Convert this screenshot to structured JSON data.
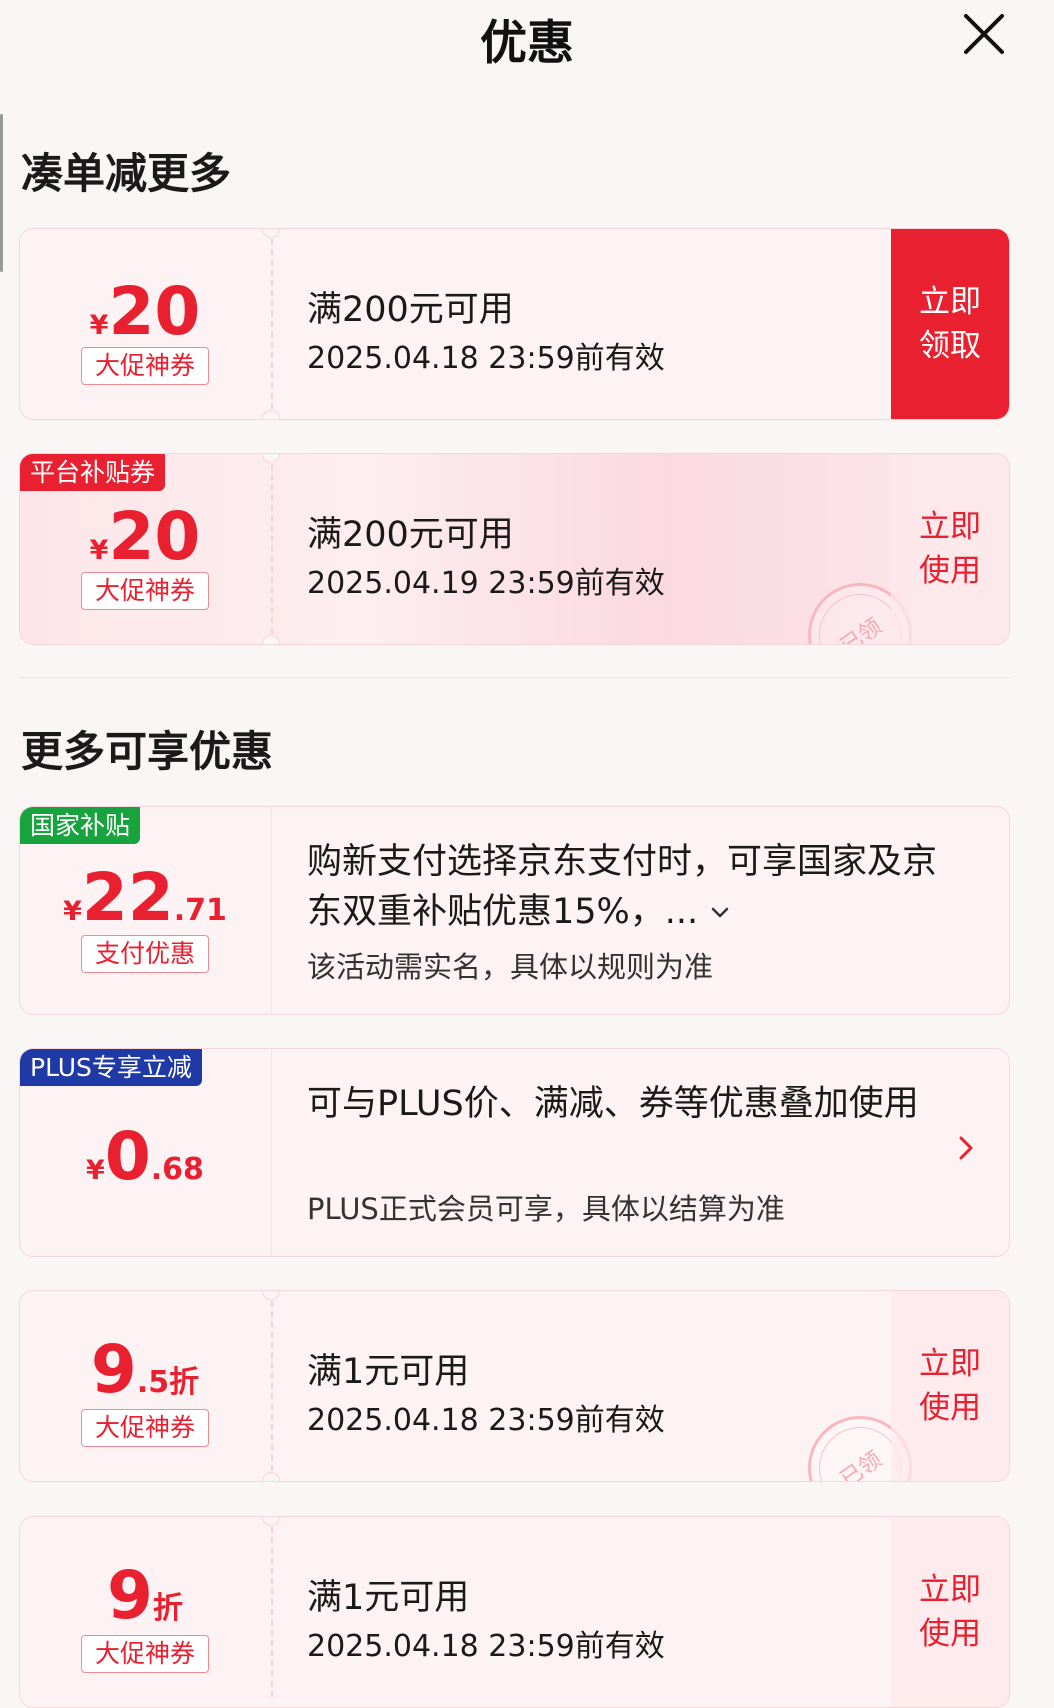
{
  "header": {
    "title": "优惠"
  },
  "sections": {
    "collect_more": "凑单减更多",
    "more_offers": "更多可享优惠"
  },
  "coupons": [
    {
      "symbol": "¥",
      "amount": "20",
      "badge": "大促神券",
      "condition": "满200元可用",
      "expiry": "2025.04.18 23:59前有效",
      "action_line1": "立即",
      "action_line2": "领取"
    },
    {
      "corner_tag": "平台补贴券",
      "symbol": "¥",
      "amount": "20",
      "badge": "大促神券",
      "condition": "满200元可用",
      "expiry": "2025.04.19 23:59前有效",
      "action_line1": "立即",
      "action_line2": "使用",
      "stamp": "已领"
    }
  ],
  "offers": [
    {
      "corner_tag": "国家补贴",
      "symbol": "¥",
      "amount_int": "22",
      "amount_dec": ".71",
      "badge": "支付优惠",
      "description": "购新支付选择京东支付时，可享国家及京东双重补贴优惠15%，...",
      "note": "该活动需实名，具体以规则为准"
    },
    {
      "corner_tag": "PLUS专享立减",
      "symbol": "¥",
      "amount_int": "0",
      "amount_dec": ".68",
      "description": "可与PLUS价、满减、券等优惠叠加使用",
      "note": "PLUS正式会员可享，具体以结算为准"
    }
  ],
  "discounts": [
    {
      "amount_int": "9",
      "amount_dec": ".5",
      "unit": "折",
      "badge": "大促神券",
      "condition": "满1元可用",
      "expiry": "2025.04.18 23:59前有效",
      "action_line1": "立即",
      "action_line2": "使用",
      "stamp": "已领"
    },
    {
      "amount_int": "9",
      "unit": "折",
      "badge": "大促神券",
      "condition": "满1元可用",
      "expiry": "2025.04.18 23:59前有效",
      "action_line1": "立即",
      "action_line2": "使用"
    }
  ],
  "colors": {
    "accent_red": "#e8202f",
    "tag_green": "#19a33e",
    "tag_navy": "#1f3aa6",
    "page_bg": "#fbf6f6"
  },
  "icons": [
    "close-icon",
    "chevron-down-icon",
    "chevron-right-icon"
  ]
}
